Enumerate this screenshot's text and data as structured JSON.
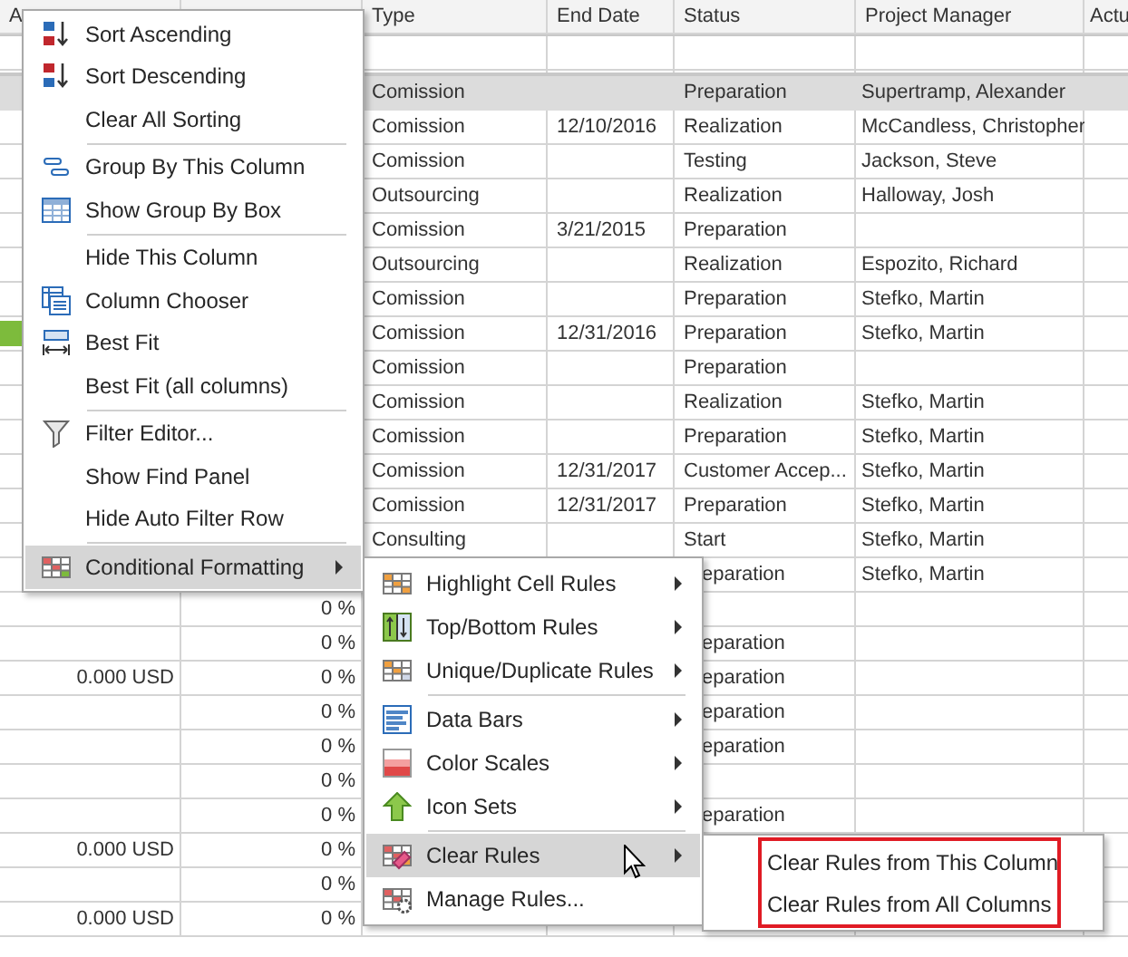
{
  "grid": {
    "header": {
      "column_1": "A",
      "type": "Type",
      "end_date": "End Date",
      "status": "Status",
      "project_manager": "Project Manager",
      "column_7": "Actu"
    },
    "rows": [
      {
        "type": "Comission",
        "status": "Preparation",
        "project_manager": "Supertramp, Alexander",
        "selected": true
      },
      {
        "type": "Comission",
        "end_date": "12/10/2016",
        "status": "Realization",
        "project_manager": "McCandless, Christopher",
        "selected": false
      },
      {
        "type": "Comission",
        "status": "Testing",
        "project_manager": "Jackson, Steve",
        "selected": false
      },
      {
        "type": "Outsourcing",
        "status": "Realization",
        "project_manager": "Halloway, Josh",
        "selected": false
      },
      {
        "type": "Comission",
        "end_date": "3/21/2015",
        "status": "Preparation",
        "selected": false
      },
      {
        "type": "Outsourcing",
        "status": "Realization",
        "project_manager": "Espozito, Richard",
        "selected": false
      },
      {
        "type": "Comission",
        "status": "Preparation",
        "project_manager": "Stefko, Martin",
        "selected": false
      },
      {
        "type": "Comission",
        "end_date": "12/31/2016",
        "status": "Preparation",
        "project_manager": "Stefko, Martin",
        "selected": false,
        "data_bar": true
      },
      {
        "type": "Comission",
        "status": "Preparation",
        "selected": false
      },
      {
        "type": "Comission",
        "status": "Realization",
        "project_manager": "Stefko, Martin",
        "selected": false
      },
      {
        "type": "Comission",
        "status": "Preparation",
        "project_manager": "Stefko, Martin",
        "selected": false
      },
      {
        "type": "Comission",
        "end_date": "12/31/2017",
        "status": "Customer Accep...",
        "project_manager": "Stefko, Martin",
        "selected": false
      },
      {
        "type": "Comission",
        "end_date": "12/31/2017",
        "status": "Preparation",
        "project_manager": "Stefko, Martin",
        "selected": false
      },
      {
        "type": "Consulting",
        "status": "Start",
        "project_manager": "Stefko, Martin",
        "selected": false
      },
      {
        "status": "eparation",
        "project_manager": "Stefko, Martin",
        "selected": false,
        "covered": true
      },
      {
        "column_2": "0 %",
        "selected": false
      },
      {
        "column_2": "0 %",
        "status": "eparation",
        "selected": false,
        "covered": true
      },
      {
        "column_1": "0.000 USD",
        "column_2": "0 %",
        "status": "eparation",
        "selected": false,
        "covered": true
      },
      {
        "column_2": "0 %",
        "status": "eparation",
        "selected": false,
        "covered": true
      },
      {
        "column_2": "0 %",
        "status": "eparation",
        "selected": false,
        "covered": true
      },
      {
        "column_2": "0 %",
        "selected": false
      },
      {
        "column_2": "0 %",
        "status": "eparation",
        "selected": false,
        "covered": true
      },
      {
        "column_1": "0.000 USD",
        "column_2": "0 %",
        "selected": false
      },
      {
        "column_2": "0 %",
        "selected": false
      },
      {
        "column_1": "0.000 USD",
        "column_2": "0 %",
        "selected": false
      }
    ]
  },
  "context_menu": {
    "items": [
      {
        "label": "Sort Ascending",
        "selected": false,
        "separator_before": false,
        "has_submenu": false
      },
      {
        "label": "Sort Descending",
        "selected": false,
        "separator_before": false,
        "has_submenu": false
      },
      {
        "label": "Clear All Sorting",
        "selected": false,
        "separator_before": false,
        "has_submenu": false
      },
      {
        "label": "Group By This Column",
        "selected": false,
        "separator_before": true,
        "has_submenu": false
      },
      {
        "label": "Show Group By Box",
        "selected": false,
        "separator_before": false,
        "has_submenu": false
      },
      {
        "label": "Hide This Column",
        "selected": false,
        "separator_before": true,
        "has_submenu": false
      },
      {
        "label": "Column Chooser",
        "selected": false,
        "separator_before": false,
        "has_submenu": false
      },
      {
        "label": "Best Fit",
        "selected": false,
        "separator_before": false,
        "has_submenu": false
      },
      {
        "label": "Best Fit (all columns)",
        "selected": false,
        "separator_before": false,
        "has_submenu": false
      },
      {
        "label": "Filter Editor...",
        "selected": false,
        "separator_before": true,
        "has_submenu": false
      },
      {
        "label": "Show Find Panel",
        "selected": false,
        "separator_before": false,
        "has_submenu": false
      },
      {
        "label": "Hide Auto Filter Row",
        "selected": false,
        "separator_before": false,
        "has_submenu": false
      },
      {
        "label": "Conditional Formatting",
        "selected": true,
        "separator_before": true,
        "has_submenu": true
      }
    ]
  },
  "submenu": {
    "items": [
      {
        "label": "Highlight Cell Rules",
        "selected": false,
        "separator_before": false,
        "has_submenu": true
      },
      {
        "label": "Top/Bottom Rules",
        "selected": false,
        "separator_before": false,
        "has_submenu": true
      },
      {
        "label": "Unique/Duplicate Rules",
        "selected": false,
        "separator_before": false,
        "has_submenu": true
      },
      {
        "label": "Data Bars",
        "selected": false,
        "separator_before": true,
        "has_submenu": true
      },
      {
        "label": "Color Scales",
        "selected": false,
        "separator_before": false,
        "has_submenu": true
      },
      {
        "label": "Icon Sets",
        "selected": false,
        "separator_before": false,
        "has_submenu": true
      },
      {
        "label": "Clear Rules",
        "selected": true,
        "separator_before": true,
        "has_submenu": true
      },
      {
        "label": "Manage Rules...",
        "selected": false,
        "separator_before": false,
        "has_submenu": false
      }
    ]
  },
  "clear_rules_menu": {
    "items": [
      {
        "label": "Clear Rules from This Column",
        "selected": false
      },
      {
        "label": "Clear Rules from All Columns",
        "selected": false
      }
    ]
  }
}
